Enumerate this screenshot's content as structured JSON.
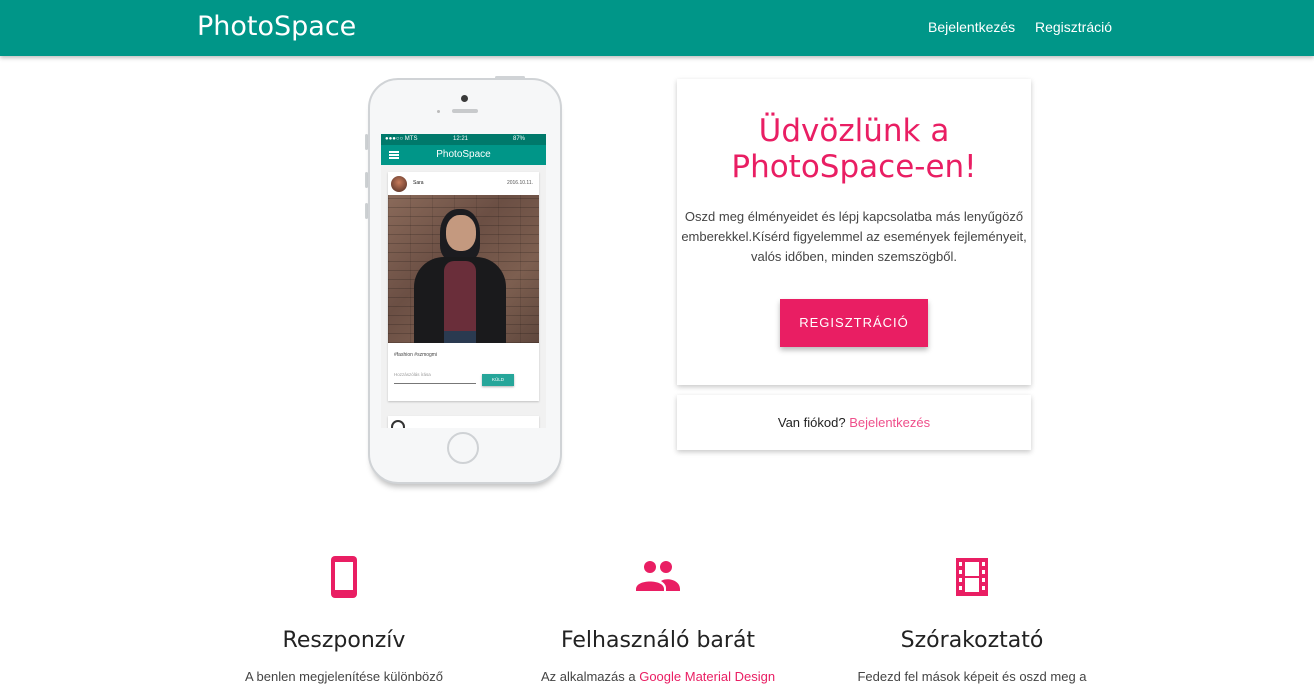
{
  "nav": {
    "brand": "PhotoSpace",
    "links": [
      "Bejelentkezés",
      "Regisztráció"
    ]
  },
  "phone": {
    "status_carrier": "●●●○○ MTS",
    "status_time": "12:21",
    "status_battery": "87%",
    "app_title": "PhotoSpace",
    "post_user": "Sara",
    "post_date": "2016.10.11.",
    "post_tags": "#fashion #szmogmi",
    "comment_placeholder": "Hozzászólás írása",
    "send_label": "KÜLD"
  },
  "welcome": {
    "title_line1": "Üdvözlünk a",
    "title_line2": "PhotoSpace-en!",
    "text": "Oszd meg élményeidet és lépj kapcsolatba más lenyűgöző emberekkel.Kísérd figyelemmel az események fejleményeit, valós időben, minden szemszögből.",
    "button": "REGISZTRÁCIÓ"
  },
  "account": {
    "question": "Van fiókod?",
    "link": "Bejelentkezés"
  },
  "features": [
    {
      "icon": "smartphone-icon",
      "title": "Reszponzív",
      "text": "A benlen megjelenítése különböző"
    },
    {
      "icon": "people-icon",
      "title": "Felhasználó barát",
      "text_prefix": "Az alkalmazás a ",
      "text_link": "Google Material Design"
    },
    {
      "icon": "film-icon",
      "title": "Szórakoztató",
      "text": "Fedezd fel mások képeit és oszd meg a"
    }
  ],
  "colors": {
    "primary": "#009688",
    "accent": "#e91e63"
  }
}
